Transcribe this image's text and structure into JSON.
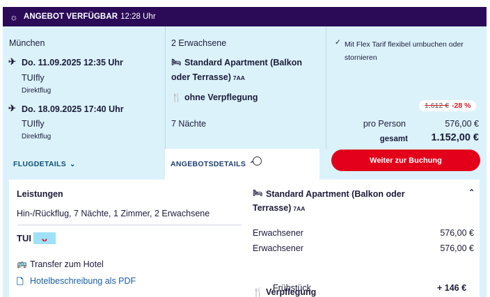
{
  "topbar": {
    "icon": "sun-icon",
    "title": "ANGEBOT VERFÜGBAR",
    "time": "12:28 Uhr",
    "bg": "#2b0b58"
  },
  "flight": {
    "departure_city": "München",
    "outbound": {
      "date": "Do. 11.09.2025 12:35 Uhr",
      "airline": "TUIfly",
      "type": "Direktflug"
    },
    "inbound": {
      "date": "Do. 18.09.2025 17:40 Uhr",
      "airline": "TUIfly",
      "type": "Direktflug"
    }
  },
  "offer": {
    "travellers": "2 Erwachsene",
    "room_name_l1": "Standard Apartment (Balkon",
    "room_name_l2": "oder Terrasse)",
    "room_code": "7AA",
    "board": "ohne Verpflegung",
    "nights": "7 Nächte"
  },
  "price": {
    "flex_note": "Mit Flex Tarif flexibel umbuchen oder stornieren",
    "old_price": "1.612 €",
    "discount": "-28 %",
    "per_person_label": "pro Person",
    "per_person_value": "576,00 €",
    "total_label": "gesamt",
    "total_value": "1.152,00 €",
    "cta": "Weiter zur Buchung",
    "accent": "#e2001a"
  },
  "tabs": {
    "flight_details": "FLUGDETAILS",
    "offer_details": "ANGEBOTSDETAILS"
  },
  "details": {
    "services_title": "Leistungen",
    "services_text": "Hin-/Rückflug, 7 Nächte, 1 Zimmer, 2 Erwachsene",
    "brand": "TUI",
    "transfer": "Transfer zum Hotel",
    "pdf_link": "Hotelbeschreibung als PDF",
    "room_title_l1": "Standard Apartment (Balkon oder",
    "room_title_l2": "Terrasse)",
    "room_code": "7AA",
    "rows": [
      {
        "label": "Erwachsener",
        "value": "576,00 €"
      },
      {
        "label": "Erwachsener",
        "value": "576,00 €"
      }
    ],
    "board_title": "Verpflegung",
    "board_option": "Frühstück",
    "board_option_price": "+ 146 €"
  }
}
